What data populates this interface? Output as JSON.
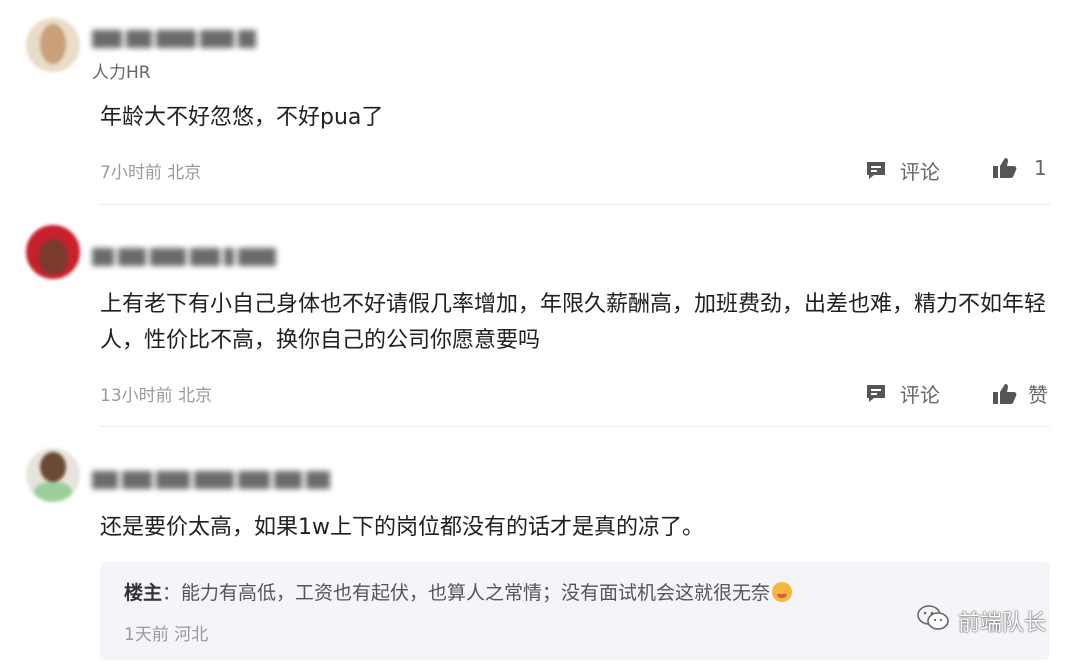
{
  "comments": [
    {
      "user_sub": "人力HR",
      "text": "年龄大不好忽悠，不好pua了",
      "time_location": "7小时前 北京",
      "comment_label": "评论",
      "like_label": "1"
    },
    {
      "user_sub": "",
      "text": "上有老下有小自己身体也不好请假几率增加，年限久薪酬高，加班费劲，出差也难，精力不如年轻人，性价比不高，换你自己的公司你愿意要吗",
      "time_location": "13小时前 北京",
      "comment_label": "评论",
      "like_label": "赞"
    },
    {
      "user_sub": "",
      "text": "还是要价太高，如果1w上下的岗位都没有的话才是真的凉了。",
      "reply": {
        "author": "楼主",
        "separator": "：",
        "text": "能力有高低，工资也有起伏，也算人之常情；没有面试机会这就很无奈",
        "time_location": "1天前 河北"
      }
    }
  ],
  "watermark": {
    "text": "前端队长",
    "icon": "wechat-icon"
  },
  "colors": {
    "text": "#1f1f1f",
    "meta": "#9a9a9a",
    "reply_bg": "#f4f5f8"
  }
}
